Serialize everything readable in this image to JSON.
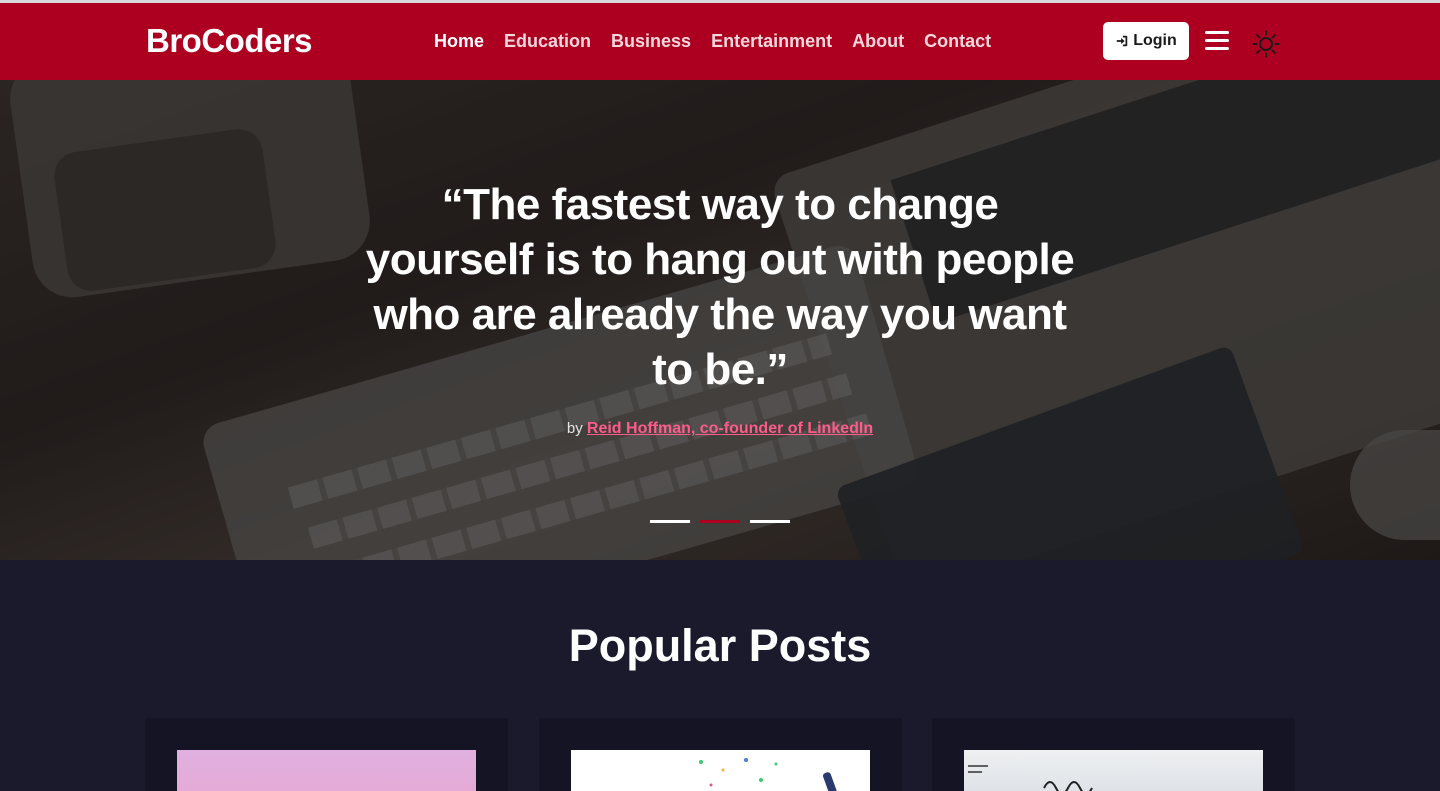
{
  "brand": "BroCoders",
  "nav": {
    "links": [
      "Home",
      "Education",
      "Business",
      "Entertainment",
      "About",
      "Contact"
    ],
    "active": "Home",
    "login_label": "Login"
  },
  "hero": {
    "quote": "“The fastest way to change yourself is to hang out with people who are already the way you want to be.”",
    "by_prefix": "by",
    "author": "Reid Hoffman, co-founder of LinkedIn",
    "slides": 3,
    "active_slide": 2
  },
  "popular": {
    "title": "Popular Posts"
  },
  "colors": {
    "brand_red": "#ad0020",
    "link_pink": "#ff5c8a",
    "background_dark": "#1b1a2c"
  }
}
